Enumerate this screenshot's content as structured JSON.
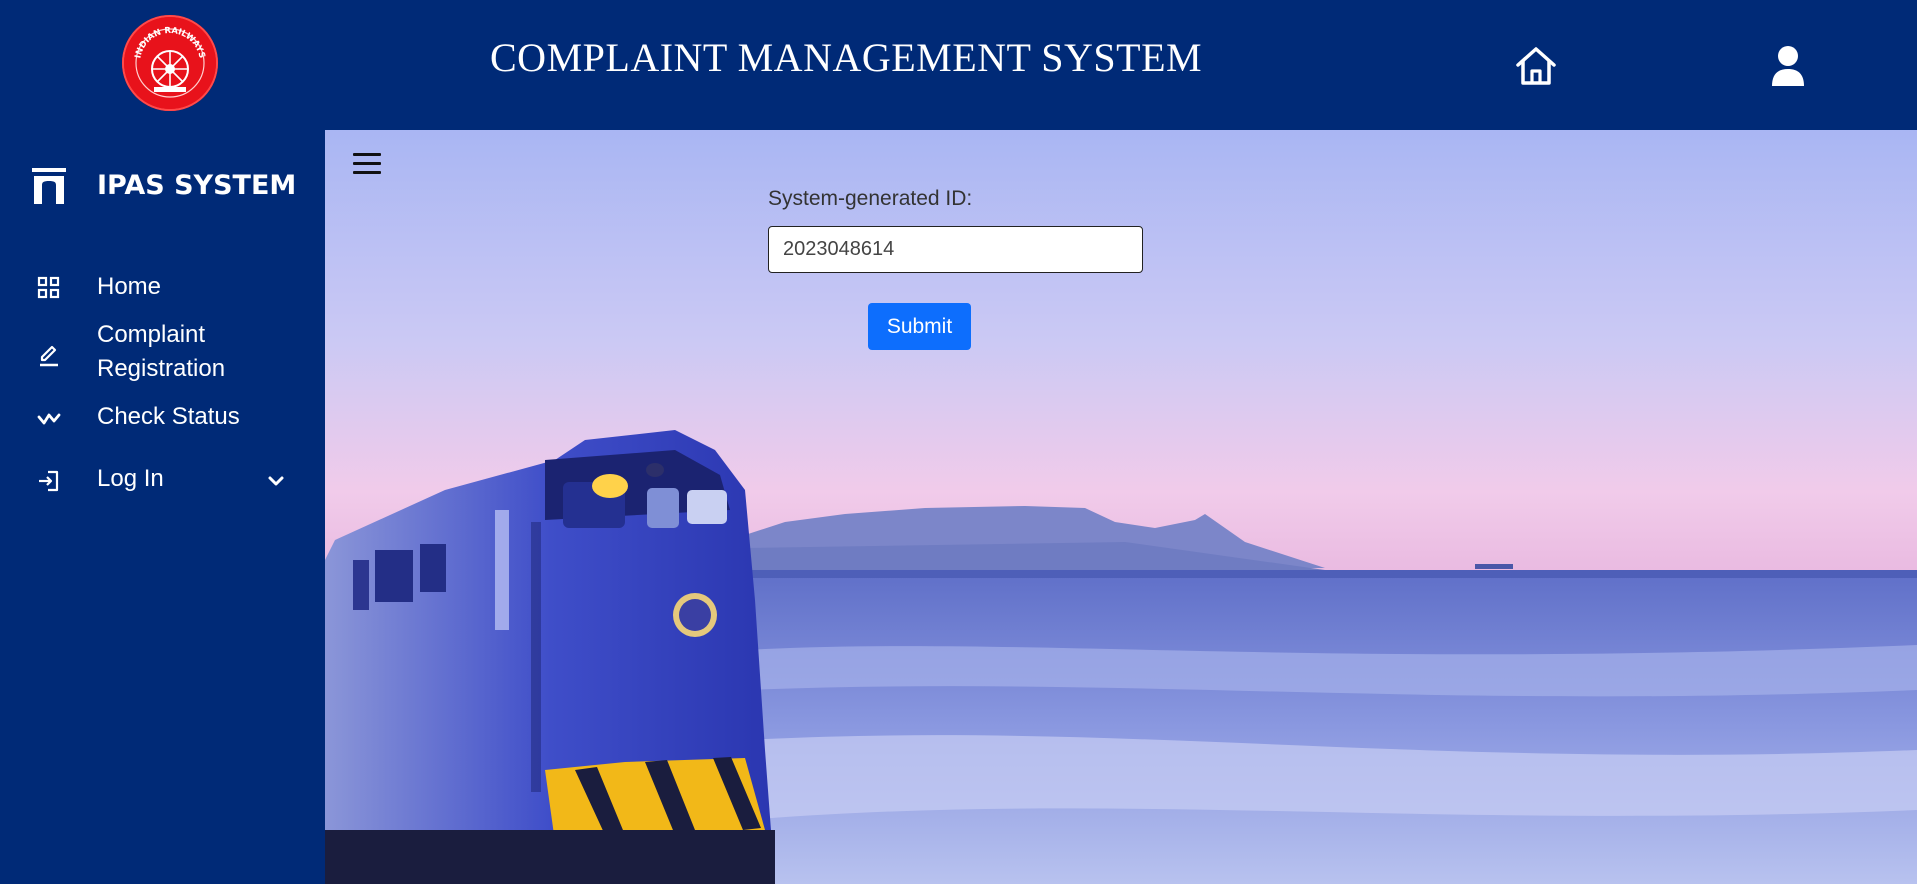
{
  "header": {
    "logo_text": "INDIAN RAILWAYS",
    "title": "COMPLAINT MANAGEMENT SYSTEM",
    "home_icon": "home-icon",
    "user_icon": "user-icon"
  },
  "sidebar": {
    "brand": "IPAS SYSTEM",
    "brand_icon": "arch-icon",
    "items": [
      {
        "label": "Home",
        "icon": "grid-icon"
      },
      {
        "label_line1": "Complaint",
        "label_line2": "Registration",
        "icon": "pencil-icon"
      },
      {
        "label": "Check Status",
        "icon": "activity-icon"
      },
      {
        "label": "Log In",
        "icon": "login-icon",
        "expand_icon": "chevron-down-icon"
      }
    ]
  },
  "main": {
    "menu_icon": "hamburger-icon",
    "id_label": "System-generated ID:",
    "id_value": "2023048614",
    "submit_label": "Submit"
  },
  "colors": {
    "navy": "#002a77",
    "button": "#0d6efd",
    "logo_red": "#e8121b"
  }
}
